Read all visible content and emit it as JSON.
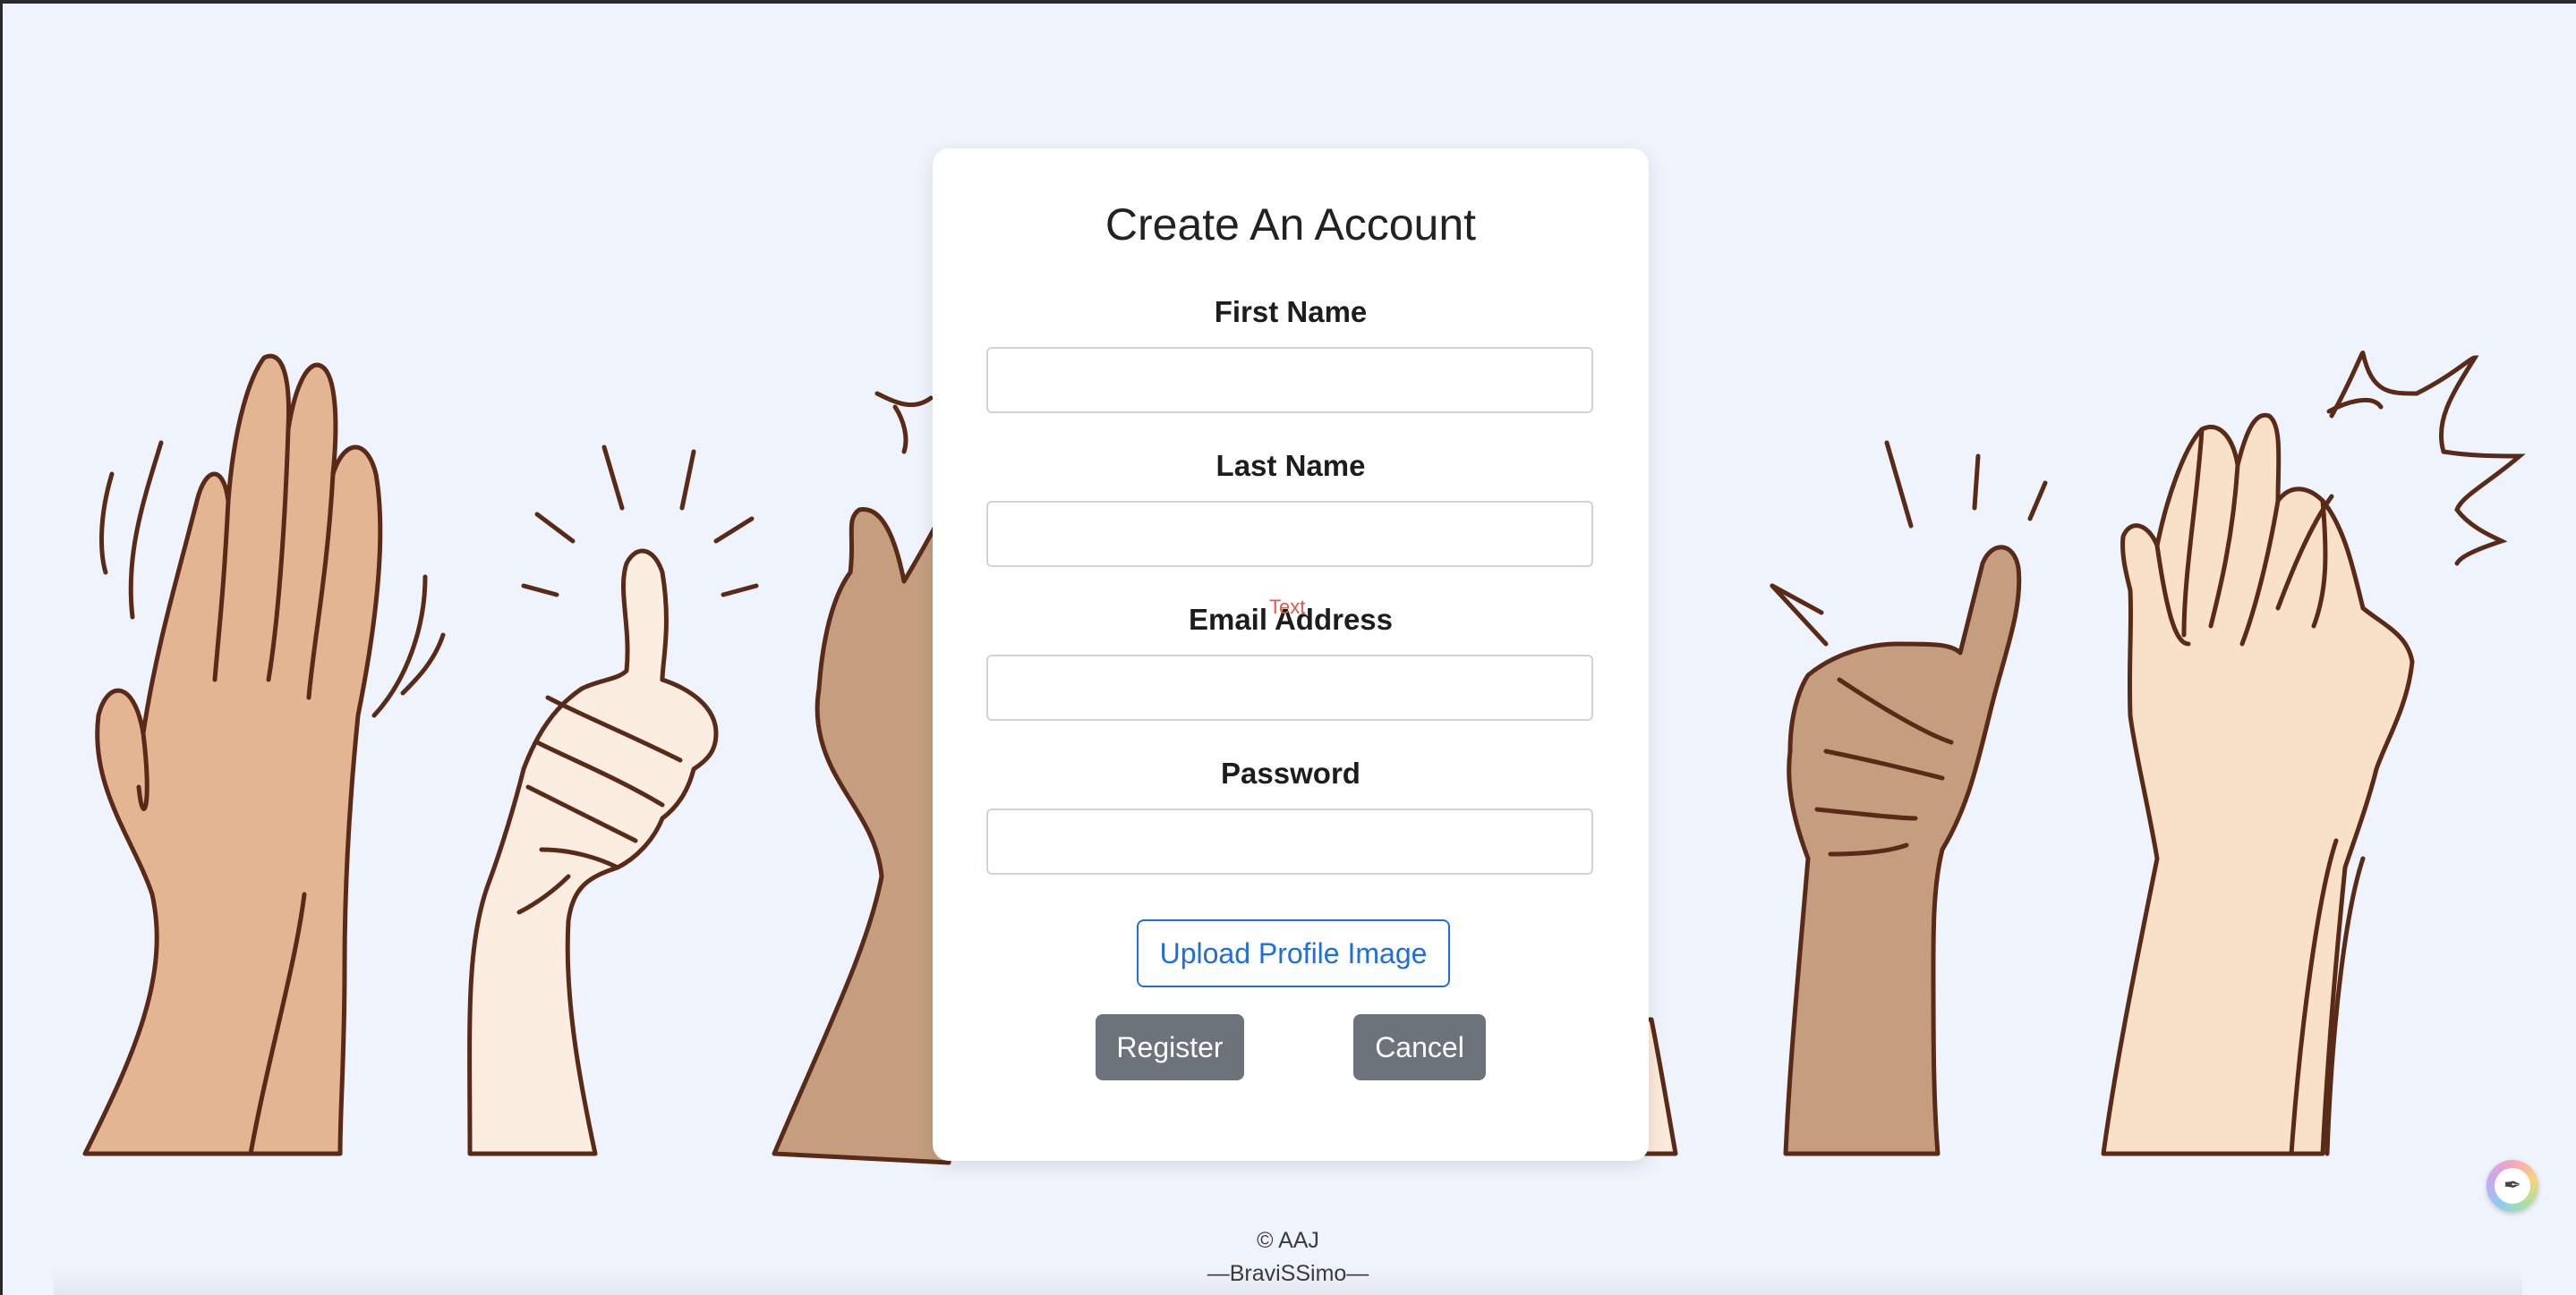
{
  "form": {
    "title": "Create An Account",
    "fields": [
      {
        "label": "First Name",
        "value": "",
        "placeholder": ""
      },
      {
        "label": "Last Name",
        "value": "",
        "placeholder": ""
      },
      {
        "label": "Email Address",
        "value": "",
        "placeholder": ""
      },
      {
        "label": "Password",
        "value": "",
        "placeholder": ""
      }
    ],
    "stray_text": "Text",
    "upload_label": "Upload Profile Image",
    "register_label": "Register",
    "cancel_label": "Cancel"
  },
  "footer": {
    "copyright": "© AAJ",
    "brand": "—BraviSSimo—"
  },
  "colors": {
    "page_background": "#eff3fb",
    "card_background": "#ffffff",
    "accent_blue": "#1f6ee0",
    "button_gray": "#6c737b",
    "stray_text": "#e8584f"
  },
  "icons": {
    "color_picker": "eyedropper-icon"
  },
  "illustration": {
    "subject": "clapping hands and thumbs up"
  }
}
